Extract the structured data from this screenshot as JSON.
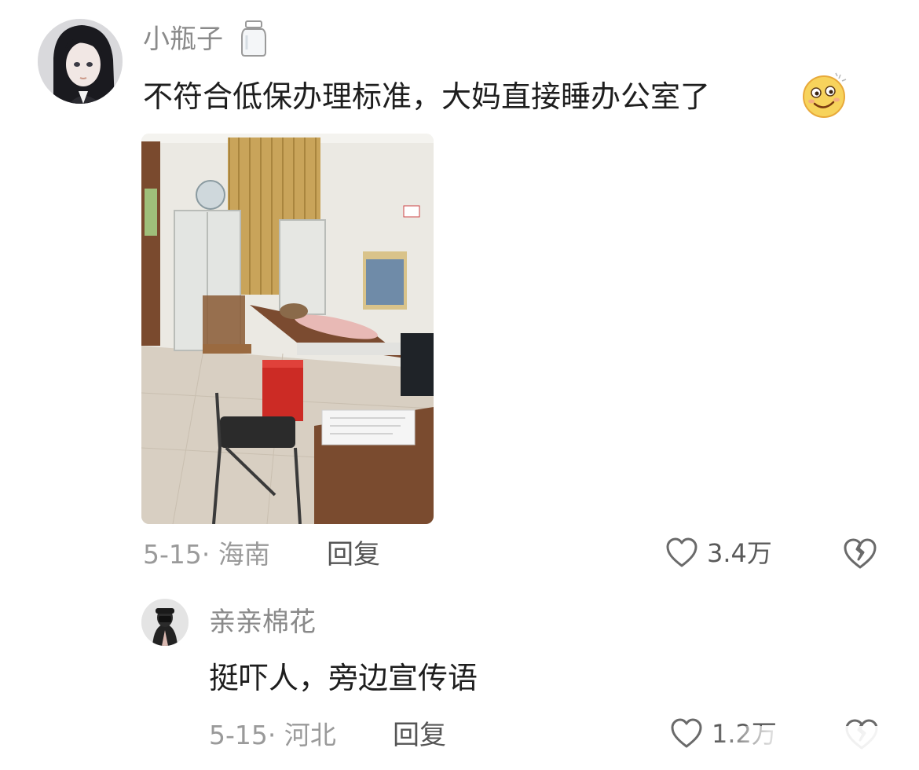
{
  "comments": [
    {
      "username": "小瓶子",
      "text": "不符合低保办理标准，大妈直接睡办公室了",
      "date": "5-15",
      "location": "海南",
      "meta_separator": "·",
      "reply_label": "回复",
      "likes": "3.4万",
      "has_image": true,
      "username_icon": "jar-icon",
      "text_emoji": "smiling-face-emoji-icon"
    },
    {
      "username": "亲亲棉花",
      "text": "挺吓人，旁边宣传语",
      "date": "5-15",
      "location": "河北",
      "meta_separator": "·",
      "reply_label": "回复",
      "likes": "1.2万"
    }
  ],
  "colors": {
    "username": "#8a8a8a",
    "text": "#1e1e1e",
    "meta": "#9a9a9a",
    "icon": "#6a6a6a"
  }
}
